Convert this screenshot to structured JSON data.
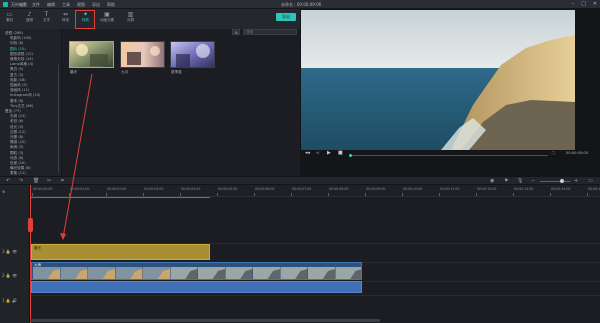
{
  "titlebar": {
    "app_name": "万兴喵影",
    "menu": [
      "文件",
      "编辑",
      "工具",
      "视图",
      "导出",
      "帮助"
    ],
    "project": "未命名 : 00:00:09:06"
  },
  "tooltabs": [
    {
      "label": "素材",
      "icon": "folder-icon"
    },
    {
      "label": "音频",
      "icon": "music-icon"
    },
    {
      "label": "文字",
      "icon": "text-icon"
    },
    {
      "label": "转场",
      "icon": "transition-icon"
    },
    {
      "label": "特效",
      "icon": "effects-icon",
      "active": true
    },
    {
      "label": "动画元素",
      "icon": "element-icon"
    },
    {
      "label": "分屏",
      "icon": "split-icon"
    }
  ],
  "export_label": "导出",
  "library": {
    "categories": [
      "滤镜 (286)",
      "电影风 (100)",
      "闪烁 (6)",
      "图片 (15)",
      "图形滤镜 (12)",
      "暗角光效 (14)",
      "Lomo风格 (4)",
      "黑白 (5)",
      "复古 (3)",
      "电影 (16)",
      "插画风 (5)",
      "漫画风 (11)",
      "Instagram风 (24)",
      "基本 (8)",
      "Tiny文艺 (66)",
      "叠加 (77)",
      "光斑 (13)",
      "老旧 (6)",
      "炫光 (5)",
      "边框 (12)",
      "光晕 (8)",
      "情感 (10)",
      "雨滴 (3)",
      "颗粒 (3)",
      "动态 (6)",
      "色差 (10)",
      "曝光效果 (8)",
      "柔焦 (11)"
    ],
    "selected_index": 3,
    "search_placeholder": "搜索",
    "items": [
      {
        "label": "晨光"
      },
      {
        "label": "九月"
      },
      {
        "label": "夏季蓝"
      }
    ]
  },
  "preview": {
    "timecode": "00:00:00:00"
  },
  "ruler": [
    "00:00:00:00",
    "00:00:01:00",
    "00:00:02:00",
    "00:00:03:00",
    "00:00:04:00",
    "00:00:05:00",
    "00:00:06:00",
    "00:00:07:00",
    "00:00:08:00",
    "00:00:09:00",
    "00:00:10:00",
    "00:00:11:00",
    "00:00:12:00",
    "00:00:13:00",
    "00:00:14:00",
    "00:00:15:00"
  ],
  "tracks": {
    "title_clip_label": "晨光",
    "video_clip_label": "大海",
    "track_labels": [
      "3",
      "2",
      "1"
    ]
  },
  "colors": {
    "accent": "#36d1c4",
    "highlight": "#e0403a",
    "title_clip": "#a98f33",
    "video_clip": "#2f4f7c",
    "audio_clip": "#3f6fb5"
  }
}
